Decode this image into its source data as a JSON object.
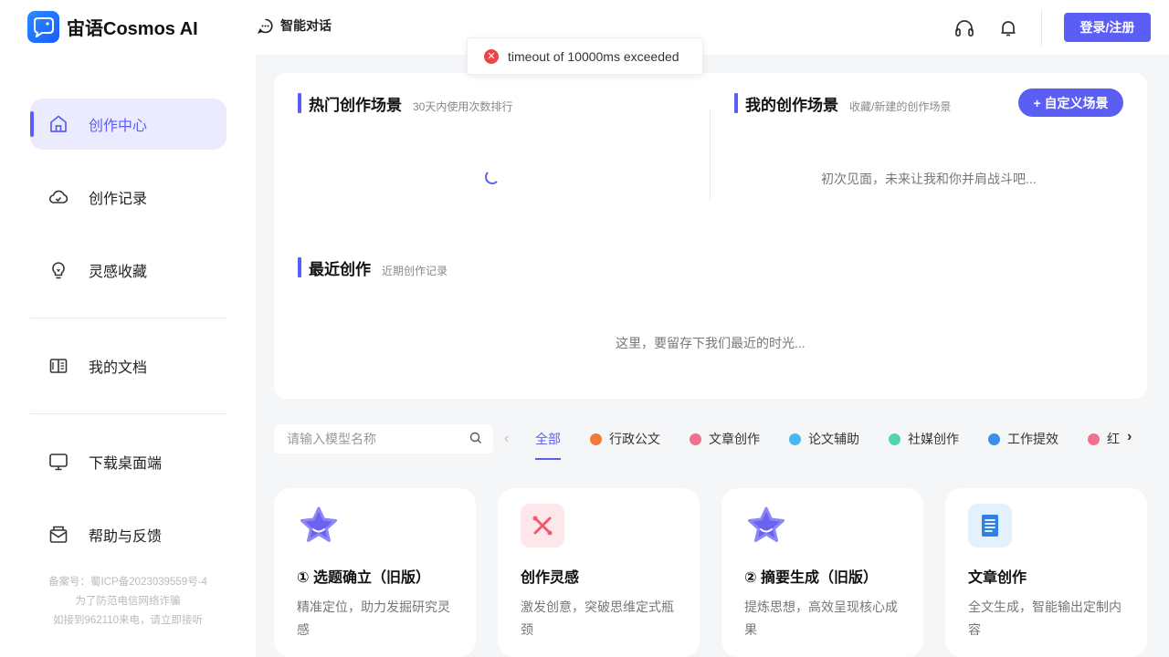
{
  "header": {
    "app_name": "宙语Cosmos AI",
    "nav_chat": "智能对话",
    "login_label": "登录/注册"
  },
  "toast": {
    "message": "timeout of 10000ms exceeded"
  },
  "sidebar": {
    "items": [
      {
        "label": "创作中心"
      },
      {
        "label": "创作记录"
      },
      {
        "label": "灵感收藏"
      },
      {
        "label": "我的文档"
      },
      {
        "label": "下载桌面端"
      },
      {
        "label": "帮助与反馈"
      }
    ],
    "footer": {
      "line1": "备案号：蜀ICP备2023039559号-4",
      "line2": "为了防范电信网络诈骗",
      "line3": "如接到962110来电，请立即接听"
    }
  },
  "panel": {
    "hot": {
      "title": "热门创作场景",
      "subtitle": "30天内使用次数排行"
    },
    "mine": {
      "title": "我的创作场景",
      "subtitle": "收藏/新建的创作场景",
      "empty": "初次见面，未来让我和你并肩战斗吧...",
      "custom_btn": "+ 自定义场景"
    },
    "recent": {
      "title": "最近创作",
      "subtitle": "近期创作记录",
      "empty": "这里，要留存下我们最近的时光..."
    }
  },
  "filter": {
    "search_placeholder": "请输入模型名称",
    "tabs": [
      {
        "label": "全部",
        "color": ""
      },
      {
        "label": "行政公文",
        "color": "#f07a3a"
      },
      {
        "label": "文章创作",
        "color": "#f2718e"
      },
      {
        "label": "论文辅助",
        "color": "#48b8f5"
      },
      {
        "label": "社媒创作",
        "color": "#4fd6ad"
      },
      {
        "label": "工作提效",
        "color": "#3d8ef0"
      },
      {
        "label": "红",
        "color": "#f2718e"
      }
    ]
  },
  "cards": [
    {
      "title": "① 选题确立（旧版）",
      "desc": "精准定位，助力发掘研究灵感",
      "icon": "star-icon"
    },
    {
      "title": "创作灵感",
      "desc": "激发创意，突破思维定式瓶颈",
      "icon": "inspiration-icon"
    },
    {
      "title": "② 摘要生成（旧版）",
      "desc": "提炼思想，高效呈现核心成果",
      "icon": "star-icon"
    },
    {
      "title": "文章创作",
      "desc": "全文生成，智能输出定制内容",
      "icon": "book-icon"
    }
  ],
  "colors": {
    "accent": "#5b5ef4"
  }
}
